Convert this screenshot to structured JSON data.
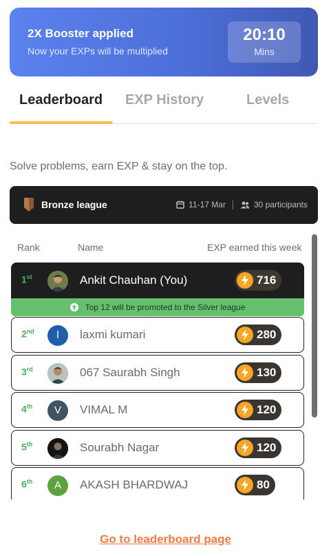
{
  "banner": {
    "title": "2X Booster applied",
    "subtitle": "Now your EXPs will be multiplied",
    "timer_value": "20:10",
    "timer_unit": "Mins"
  },
  "tabs": [
    {
      "label": "Leaderboard",
      "active": true
    },
    {
      "label": "EXP History",
      "active": false
    },
    {
      "label": "Levels",
      "active": false
    }
  ],
  "tagline": "Solve problems, earn EXP & stay on the top.",
  "league": {
    "name": "Bronze league",
    "dates": "11-17 Mar",
    "participants": "30 participants",
    "icon": "bronze-shield-icon"
  },
  "columns": {
    "rank": "Rank",
    "name": "Name",
    "exp": "EXP earned this week"
  },
  "promotion_text": "Top 12 will be promoted to the Silver league",
  "rows": [
    {
      "rank": "1",
      "suffix": "st",
      "name": "Ankit Chauhan (You)",
      "exp": "716",
      "avatar": "",
      "avatar_color": "#5a6b3e",
      "is_me": true
    },
    {
      "rank": "2",
      "suffix": "nd",
      "name": "laxmi kumari",
      "exp": "280",
      "avatar": "l",
      "avatar_color": "#1f5fa8",
      "is_me": false
    },
    {
      "rank": "3",
      "suffix": "rd",
      "name": "067 Saurabh Singh",
      "exp": "130",
      "avatar": "",
      "avatar_color": "#7e8a7a",
      "is_me": false
    },
    {
      "rank": "4",
      "suffix": "th",
      "name": "VIMAL M",
      "exp": "120",
      "avatar": "V",
      "avatar_color": "#3f5566",
      "is_me": false
    },
    {
      "rank": "5",
      "suffix": "th",
      "name": "Sourabh Nagar",
      "exp": "120",
      "avatar": "",
      "avatar_color": "#1a1a1a",
      "is_me": false
    },
    {
      "rank": "6",
      "suffix": "th",
      "name": "AKASH BHARDWAJ",
      "exp": "80",
      "avatar": "A",
      "avatar_color": "#5ea23e",
      "is_me": false
    }
  ],
  "footer_link": "Go to leaderboard page",
  "colors": {
    "accent": "#f6c04b",
    "rank_green": "#4cae5a",
    "promo_green": "#66bf6d",
    "link_orange": "#ef7b45",
    "bolt": "#f5a623"
  }
}
